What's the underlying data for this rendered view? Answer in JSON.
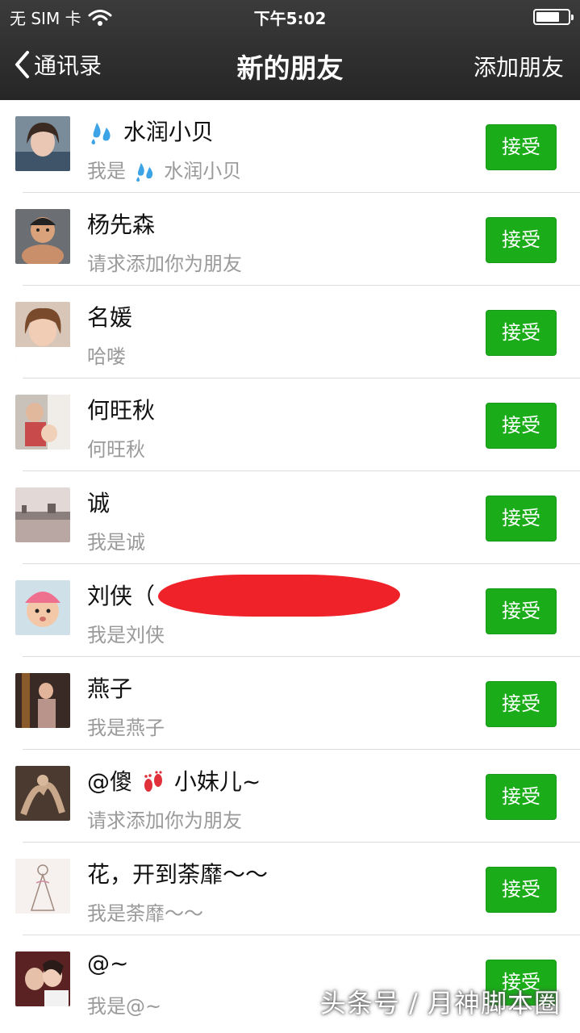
{
  "status_bar": {
    "carrier": "无 SIM 卡",
    "time": "下午5:02",
    "wifi_icon": "wifi-icon",
    "battery_icon": "battery-icon"
  },
  "nav": {
    "back_label": "通讯录",
    "title": "新的朋友",
    "add_label": "添加朋友"
  },
  "accept_label": "接受",
  "requests": [
    {
      "name_pre": "",
      "name_emoji": "sweat-drops-emoji",
      "name": "水润小贝",
      "msg_pre": "我是",
      "msg_emoji": "sweat-drops-emoji",
      "msg": "水润小贝"
    },
    {
      "name": "杨先森",
      "msg": "请求添加你为朋友"
    },
    {
      "name": "名媛",
      "msg": "哈喽"
    },
    {
      "name": "何旺秋",
      "msg": "何旺秋"
    },
    {
      "name": "诚",
      "msg": "我是诚"
    },
    {
      "name": "刘侠（",
      "msg": "我是刘侠"
    },
    {
      "name": "燕子",
      "msg": "我是燕子"
    },
    {
      "name_pre": "@傻",
      "name_emoji": "footprints-emoji",
      "name": "小妹儿~",
      "msg": "请求添加你为朋友"
    },
    {
      "name": "花，开到荼靡～～",
      "msg": "我是荼靡～～"
    },
    {
      "name": "@~",
      "msg": "我是@~"
    }
  ],
  "watermark": "头条号 / 月神脚本圈",
  "colors": {
    "accept_green": "#1aad19",
    "nav_bg": "#2e2e2e",
    "redaction": "#ee2228"
  }
}
